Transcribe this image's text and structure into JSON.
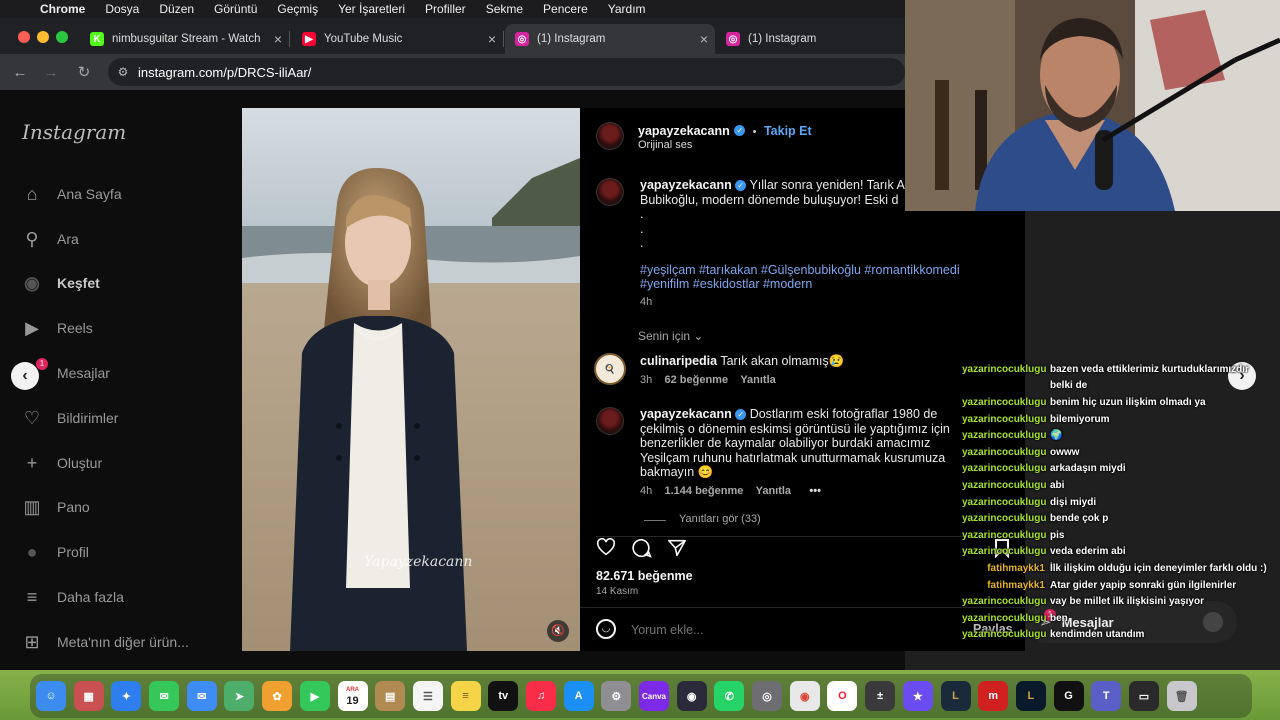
{
  "menubar": {
    "apple": "",
    "items": [
      "Chrome",
      "Dosya",
      "Düzen",
      "Görüntü",
      "Geçmiş",
      "Yer İşaretleri",
      "Profiller",
      "Sekme",
      "Pencere",
      "Yardım"
    ]
  },
  "tabs": [
    {
      "title": "nimbusguitar Stream - Watch",
      "icon_color": "#53fc18",
      "icon_letter": "K"
    },
    {
      "title": "YouTube Music",
      "icon_color": "#ff0033",
      "icon_letter": "▶"
    },
    {
      "title": "(1) Instagram",
      "icon_color": "#d6249f",
      "icon_letter": "◎"
    },
    {
      "title": "(1) Instagram",
      "icon_color": "#d6249f",
      "icon_letter": "◎"
    }
  ],
  "address": {
    "url": "instagram.com/p/DRCS-iliAar/"
  },
  "instagram": {
    "logo": "Instagram",
    "nav": [
      {
        "label": "Ana Sayfa",
        "icon": "home-icon"
      },
      {
        "label": "Ara",
        "icon": "search-icon"
      },
      {
        "label": "Keşfet",
        "icon": "explore-icon"
      },
      {
        "label": "Reels",
        "icon": "reels-icon"
      },
      {
        "label": "Mesajlar",
        "icon": "messages-icon"
      },
      {
        "label": "Bildirimler",
        "icon": "heart-icon"
      },
      {
        "label": "Oluştur",
        "icon": "plus-icon"
      },
      {
        "label": "Pano",
        "icon": "dashboard-icon"
      },
      {
        "label": "Profil",
        "icon": "profile-icon"
      },
      {
        "label": "Daha fazla",
        "icon": "menu-icon"
      },
      {
        "label": "Meta'nın diğer ürün...",
        "icon": "meta-apps-icon"
      }
    ],
    "messages_badge": "1",
    "post": {
      "watermark": "Yapayzekacann",
      "author": "yapayzekacann",
      "follow": "Takip Et",
      "dot": "•",
      "audio": "Orijinal ses",
      "caption": {
        "user": "yapayzekacann",
        "line1": "Yıllar sonra yeniden! Tarık A",
        "line2": "Bubikoğlu, modern dönemde buluşuyor! Eski d",
        "dots": [
          ".",
          ".",
          "."
        ],
        "hashtags1": "#yeşilçam #tarıkakan #Gülşenbubikoğlu #romantikkomedi",
        "hashtags2": "#yenifilm #eskidostlar #modern",
        "time": "4h"
      },
      "sort_label": "Senin için",
      "comments": [
        {
          "user": "culinaripedia",
          "text": "Tarık akan olmamış😢",
          "time": "3h",
          "likes": "62 beğenme",
          "reply": "Yanıtla"
        },
        {
          "user": "yapayzekacann",
          "lines": [
            "Dostlarım eski fotoğraflar 1980 de",
            "çekilmiş o dönemin eskimsi görüntüsü ile yaptığımız için",
            "benzerlikler de kaymalar olabiliyor burdaki amacımız",
            "Yeşilçam ruhunu hatırlatmak unutturmamak kusrumuza",
            "bakmayın 😊"
          ],
          "time": "4h",
          "likes": "1.144 beğenme",
          "reply": "Yanıtla",
          "more": "•••"
        }
      ],
      "view_replies": "Yanıtları gör (33)",
      "likes": "82.671 beğenme",
      "date": "14 Kasım",
      "comment_placeholder": "Yorum ekle...",
      "share": "Paylaş"
    },
    "floating_messages": {
      "label": "Mesajlar",
      "badge": "1"
    }
  },
  "chat": [
    {
      "user": "yazarincocuklugu",
      "msg": "bazen veda ettiklerimiz kurtuduklarımızdır",
      "color": "#a6e22e"
    },
    {
      "user": "",
      "msg": "belki de",
      "color": "#a6e22e"
    },
    {
      "user": "yazarincocuklugu",
      "msg": "benim hiç uzun ilişkim olmadı ya",
      "color": "#a6e22e"
    },
    {
      "user": "yazarincocuklugu",
      "msg": "bilemiyorum",
      "color": "#a6e22e"
    },
    {
      "user": "yazarincocuklugu",
      "msg": "🌍",
      "color": "#a6e22e"
    },
    {
      "user": "yazarincocuklugu",
      "msg": "owww",
      "color": "#a6e22e"
    },
    {
      "user": "yazarincocuklugu",
      "msg": "arkadaşın miydi",
      "color": "#a6e22e"
    },
    {
      "user": "yazarincocuklugu",
      "msg": "abi",
      "color": "#a6e22e"
    },
    {
      "user": "yazarincocuklugu",
      "msg": "dişi miydi",
      "color": "#a6e22e"
    },
    {
      "user": "yazarincocuklugu",
      "msg": "bende çok p",
      "color": "#a6e22e"
    },
    {
      "user": "yazarincocuklugu",
      "msg": "pis",
      "color": "#a6e22e"
    },
    {
      "user": "yazarincocuklugu",
      "msg": "veda ederim abi",
      "color": "#a6e22e"
    },
    {
      "user": "fatihmaykk1",
      "msg": "İlk ilişkim olduğu için deneyimler farklı oldu :)",
      "color": "#e6b422"
    },
    {
      "user": "fatihmaykk1",
      "msg": "Atar gider yapip sonraki gün ilgilenirler",
      "color": "#e6b422"
    },
    {
      "user": "yazarincocuklugu",
      "msg": "vay be millet ilk ilişkisini yaşıyor",
      "color": "#a6e22e"
    },
    {
      "user": "yazarincocuklugu",
      "msg": "ben",
      "color": "#a6e22e"
    },
    {
      "user": "yazarincocuklugu",
      "msg": "kendimden utandım",
      "color": "#a6e22e"
    }
  ],
  "dock": [
    {
      "name": "finder-icon",
      "color": "#3c8cf0",
      "g": "☺"
    },
    {
      "name": "launchpad-icon",
      "color": "#c85050",
      "g": "▦"
    },
    {
      "name": "safari-icon",
      "color": "#2f7ef0",
      "g": "✦"
    },
    {
      "name": "messages-app-icon",
      "color": "#35c759",
      "g": "✉"
    },
    {
      "name": "mail-icon",
      "color": "#3f8cf5",
      "g": "✉"
    },
    {
      "name": "maps-icon",
      "color": "#4cae6a",
      "g": "➤"
    },
    {
      "name": "photos-icon",
      "color": "#f0a030",
      "g": "✿"
    },
    {
      "name": "facetime-icon",
      "color": "#34c759",
      "g": "▶"
    },
    {
      "name": "calendar-icon",
      "color": "#ffffff",
      "g": "19",
      "fg": "#222",
      "sub": "ARA"
    },
    {
      "name": "notebook-icon",
      "color": "#b08a50",
      "g": "▤"
    },
    {
      "name": "reminders-icon",
      "color": "#f5f5f5",
      "g": "☰",
      "fg": "#555"
    },
    {
      "name": "notes-icon",
      "color": "#f5d547",
      "g": "≡",
      "fg": "#6a5a10"
    },
    {
      "name": "apple-tv-icon",
      "color": "#111111",
      "g": "tv"
    },
    {
      "name": "music-icon",
      "color": "#fa2d48",
      "g": "♫"
    },
    {
      "name": "app-store-icon",
      "color": "#1c8ff5",
      "g": "A"
    },
    {
      "name": "system-settings-icon",
      "color": "#8e8e93",
      "g": "⚙"
    },
    {
      "name": "canva-icon",
      "color": "#7d2ae8",
      "g": "Canva"
    },
    {
      "name": "obs-icon",
      "color": "#2a2a3a",
      "g": "◉"
    },
    {
      "name": "whatsapp-icon",
      "color": "#25d366",
      "g": "✆"
    },
    {
      "name": "disk-utility-icon",
      "color": "#6d6d72",
      "g": "◎"
    },
    {
      "name": "chrome-icon",
      "color": "#e8e8e8",
      "g": "◉",
      "fg": "#db4437"
    },
    {
      "name": "opera-icon",
      "color": "#ffffff",
      "g": "O",
      "fg": "#ff1b2d"
    },
    {
      "name": "calculator-icon",
      "color": "#3a3a3c",
      "g": "±"
    },
    {
      "name": "imovie-icon",
      "color": "#6a4cf0",
      "g": "★"
    },
    {
      "name": "league-icon",
      "color": "#1a2a3a",
      "g": "L",
      "fg": "#c8a44a"
    },
    {
      "name": "mackie-icon",
      "color": "#d02020",
      "g": "m"
    },
    {
      "name": "lol-client-icon",
      "color": "#0a1a2a",
      "g": "L",
      "fg": "#c8a44a"
    },
    {
      "name": "capcut-icon",
      "color": "#111111",
      "g": "G"
    },
    {
      "name": "teams-icon",
      "color": "#5a5fc8",
      "g": "T"
    },
    {
      "name": "screen-record-icon",
      "color": "#2a2a2a",
      "g": "▭"
    },
    {
      "name": "trash-icon",
      "color": "#c8c8cc",
      "g": "🗑",
      "fg": "#555"
    }
  ]
}
